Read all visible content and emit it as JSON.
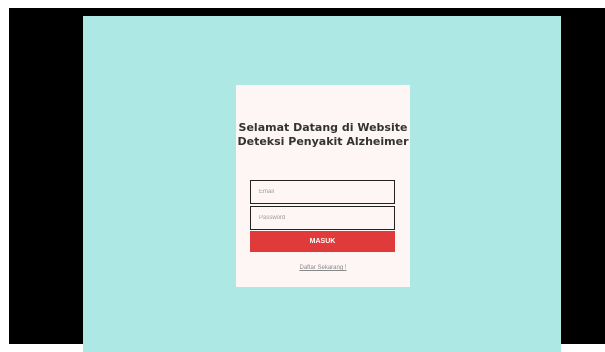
{
  "login": {
    "title_line1": "Selamat Datang di Website",
    "title_line2": "Deteksi Penyakit Alzheimer",
    "email_placeholder": "Email",
    "password_placeholder": "Password",
    "submit_label": "MASUK",
    "register_link": "Daftar Sekarang !"
  },
  "colors": {
    "background": "#aee8e4",
    "card": "#fdf6f5",
    "button": "#e03a3a",
    "letterbox": "#000000"
  }
}
